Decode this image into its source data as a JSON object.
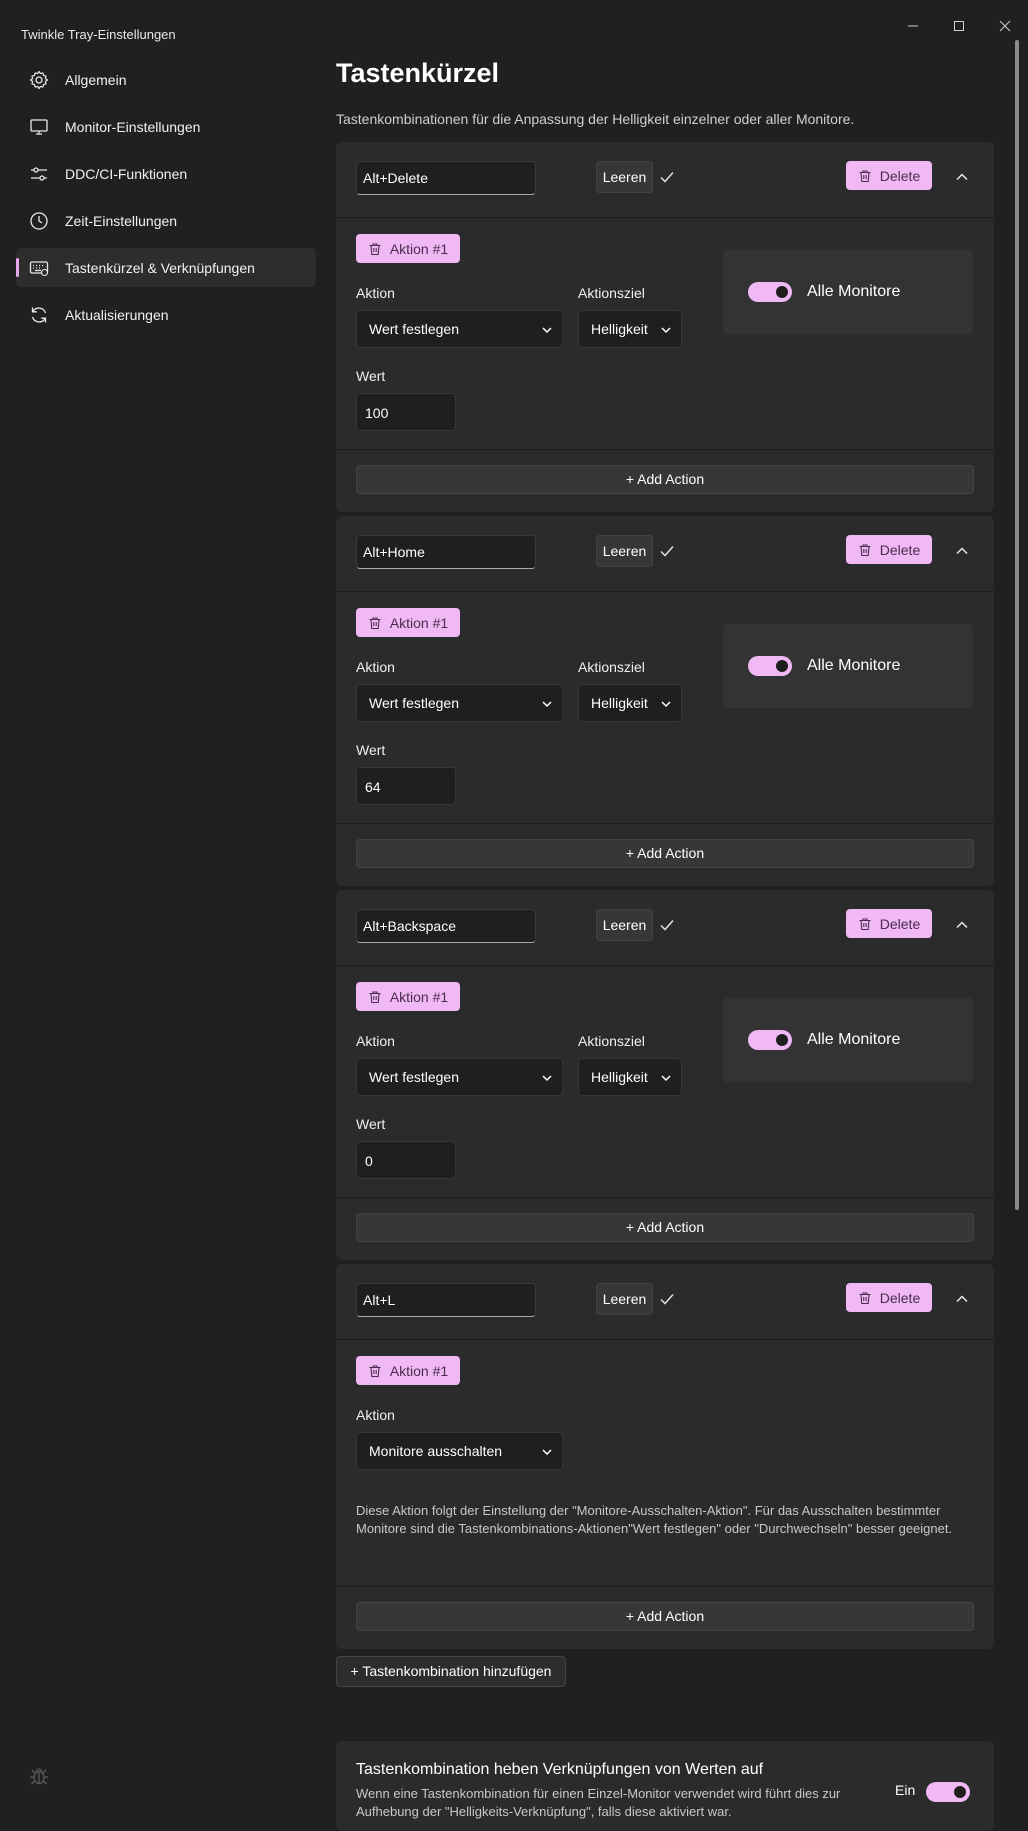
{
  "window": {
    "title": "Twinkle Tray-Einstellungen"
  },
  "sidebar": {
    "items": [
      {
        "label": "Allgemein",
        "icon": "gear-icon"
      },
      {
        "label": "Monitor-Einstellungen",
        "icon": "monitor-icon"
      },
      {
        "label": "DDC/CI-Funktionen",
        "icon": "sliders-icon"
      },
      {
        "label": "Zeit-Einstellungen",
        "icon": "clock-icon"
      },
      {
        "label": "Tastenkürzel & Verknüpfungen",
        "icon": "keyboard-icon",
        "active": true
      },
      {
        "label": "Aktualisierungen",
        "icon": "refresh-icon"
      }
    ]
  },
  "page": {
    "title": "Tastenkürzel",
    "description": "Tastenkombinationen für die Anpassung der Helligkeit einzelner oder aller Monitore."
  },
  "labels": {
    "clear": "Leeren",
    "delete": "Delete",
    "action_chip": "Aktion #1",
    "action": "Aktion",
    "action_target": "Aktionsziel",
    "value": "Wert",
    "all_monitors": "Alle Monitore",
    "add_action": "+ Add Action",
    "add_hotkey": "+ Tastenkombination hinzufügen"
  },
  "hotkeys": [
    {
      "keys": "Alt+Delete",
      "action": "Wert festlegen",
      "target": "Helligkeit",
      "value": "100",
      "all_monitors": true
    },
    {
      "keys": "Alt+Home",
      "action": "Wert festlegen",
      "target": "Helligkeit",
      "value": "64",
      "all_monitors": true
    },
    {
      "keys": "Alt+Backspace",
      "action": "Wert festlegen",
      "target": "Helligkeit",
      "value": "0",
      "all_monitors": true
    },
    {
      "keys": "Alt+L",
      "action": "Monitore ausschalten",
      "info": "Diese Aktion folgt der Einstellung der \"Monitore-Ausschalten-Aktion\". Für das Ausschalten bestimmter Monitore sind die Tastenkombinations-Aktionen\"Wert festlegen\" oder \"Durchwechseln\" besser geeignet."
    }
  ],
  "bottom_setting": {
    "title": "Tastenkombination heben Verknüpfungen von Werten auf",
    "description": "Wenn eine Tastenkombination für einen Einzel-Monitor verwendet wird führt dies zur Aufhebung der \"Helligkeits-Verknüpfung\", falls diese aktiviert war.",
    "state_label": "Ein",
    "enabled": true
  },
  "colors": {
    "accent": "#f0b8f4",
    "background": "#202020",
    "card": "#2b2b2b"
  }
}
